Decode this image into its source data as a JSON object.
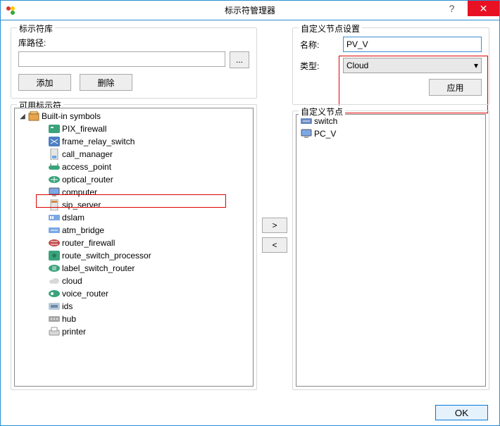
{
  "window": {
    "title": "标示符管理器",
    "help_icon": "?",
    "close_icon": "✕"
  },
  "library": {
    "group_label": "标示符库",
    "path_label": "库路径:",
    "path_value": "",
    "browse_label": "...",
    "add_label": "添加",
    "delete_label": "删除"
  },
  "available": {
    "group_label": "可用标示符",
    "root_label": "Built-in symbols",
    "items": [
      {
        "label": "PIX_firewall",
        "icon": "pix"
      },
      {
        "label": "frame_relay_switch",
        "icon": "frs"
      },
      {
        "label": "call_manager",
        "icon": "cm"
      },
      {
        "label": "access_point",
        "icon": "ap"
      },
      {
        "label": "optical_router",
        "icon": "or"
      },
      {
        "label": "computer",
        "icon": "pc"
      },
      {
        "label": "sip_server",
        "icon": "sip"
      },
      {
        "label": "dslam",
        "icon": "dslam"
      },
      {
        "label": "atm_bridge",
        "icon": "atm"
      },
      {
        "label": "router_firewall",
        "icon": "rf"
      },
      {
        "label": "route_switch_processor",
        "icon": "rsp"
      },
      {
        "label": "label_switch_router",
        "icon": "lsr"
      },
      {
        "label": "cloud",
        "icon": "cloud"
      },
      {
        "label": "voice_router",
        "icon": "vr"
      },
      {
        "label": "ids",
        "icon": "ids"
      },
      {
        "label": "hub",
        "icon": "hub"
      },
      {
        "label": "printer",
        "icon": "printer"
      }
    ]
  },
  "transfer": {
    "right_label": ">",
    "left_label": "<"
  },
  "settings": {
    "group_label": "自定义节点设置",
    "name_label": "名称:",
    "name_value": "PV_V",
    "type_label": "类型:",
    "type_value": "Cloud",
    "apply_label": "应用"
  },
  "custom_nodes": {
    "group_label": "自定义节点",
    "items": [
      {
        "label": "switch",
        "icon": "switch"
      },
      {
        "label": "PC_V",
        "icon": "pc"
      }
    ]
  },
  "footer": {
    "ok_label": "OK"
  }
}
